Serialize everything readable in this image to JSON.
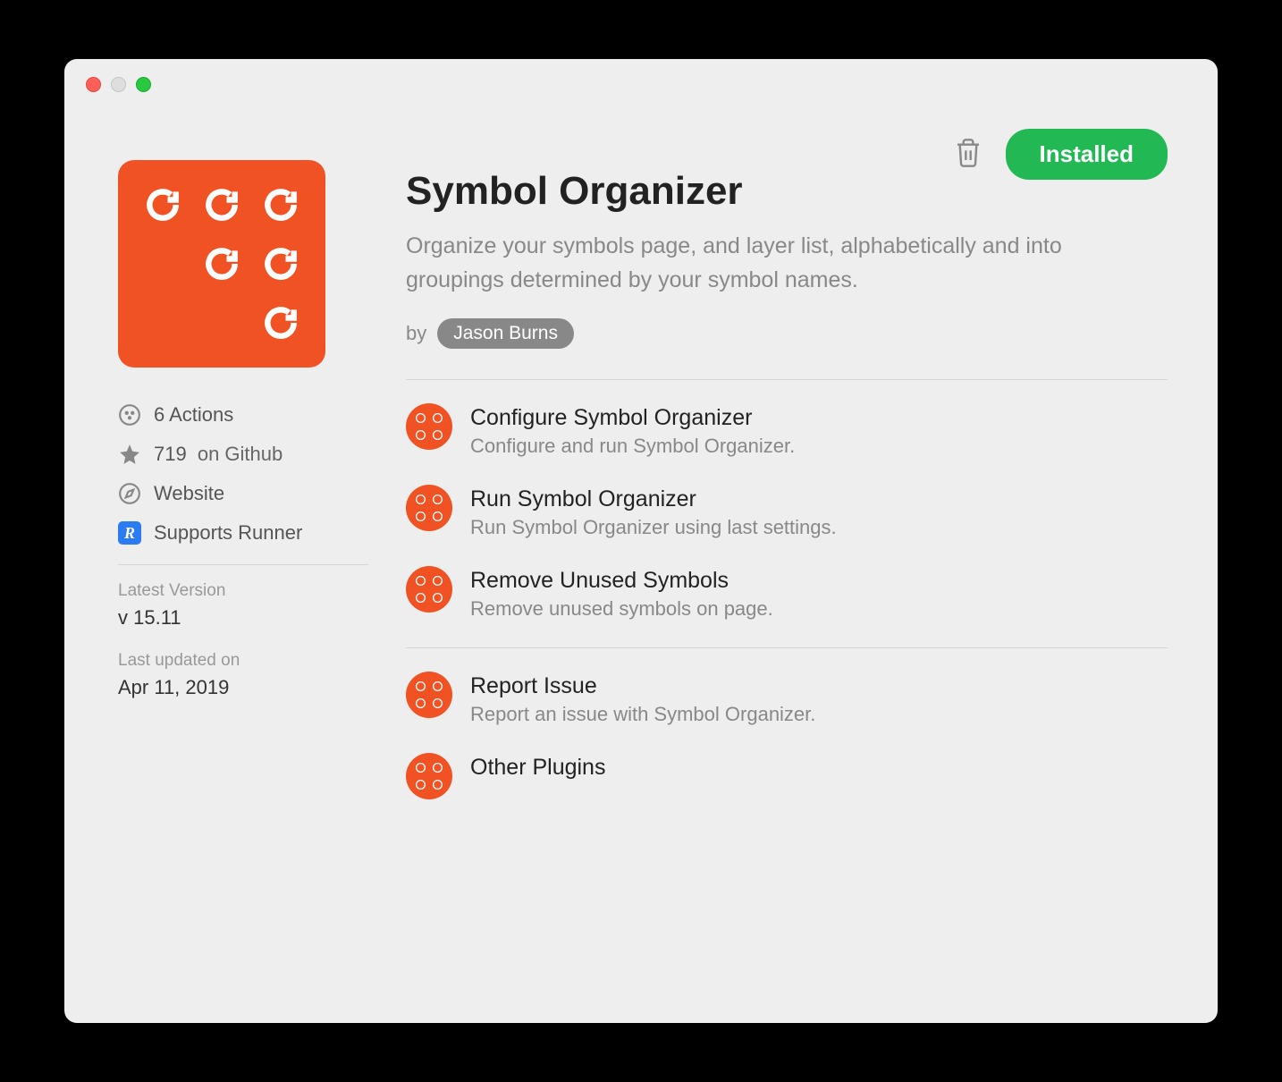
{
  "header": {
    "install_button": "Installed"
  },
  "plugin": {
    "title": "Symbol Organizer",
    "description": "Organize your symbols page, and layer list, alphabetically and into groupings determined by your symbol names.",
    "by_label": "by",
    "author": "Jason Burns"
  },
  "sidebar": {
    "actions_count": "6 Actions",
    "stars_count": "719",
    "stars_suffix": "on Github",
    "website_label": "Website",
    "runner_label": "Supports Runner",
    "version_label": "Latest Version",
    "version_value": "v 15.11",
    "updated_label": "Last updated on",
    "updated_value": "Apr 11, 2019"
  },
  "actions": [
    {
      "title": "Configure Symbol Organizer",
      "desc": "Configure and run Symbol Organizer."
    },
    {
      "title": "Run Symbol Organizer",
      "desc": "Run Symbol Organizer using last settings."
    },
    {
      "title": "Remove Unused Symbols",
      "desc": "Remove unused symbols on page."
    }
  ],
  "actions2": [
    {
      "title": "Report Issue",
      "desc": "Report an issue with Symbol Organizer."
    },
    {
      "title": "Other Plugins",
      "desc": ""
    }
  ]
}
